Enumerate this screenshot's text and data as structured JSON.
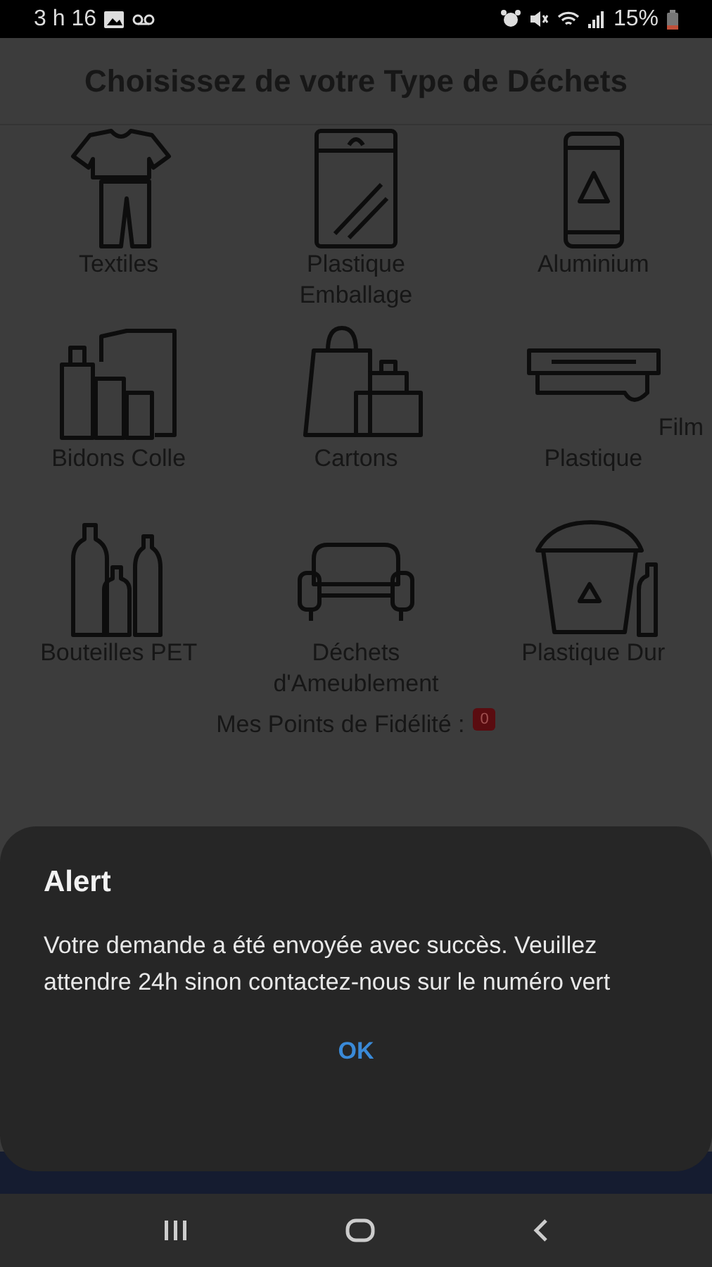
{
  "status_bar": {
    "time": "3 h 16",
    "battery": "15%"
  },
  "header": {
    "title": "Choisissez de votre Type de Déchets"
  },
  "waste_types": [
    {
      "label": "Textiles"
    },
    {
      "label": "Plastique Emballage"
    },
    {
      "label": "Aluminium"
    },
    {
      "label": "Bidons Colle"
    },
    {
      "label": "Cartons"
    },
    {
      "label": "Plastique",
      "note": "Film"
    },
    {
      "label": "Bouteilles PET"
    },
    {
      "label": "Déchets d'Ameublement"
    },
    {
      "label": "Plastique Dur"
    }
  ],
  "loyalty": {
    "label": "Mes Points de Fidélité :",
    "points": "0"
  },
  "dialog": {
    "title": "Alert",
    "message": "Votre demande a été envoyée avec succès. Veuillez attendre 24h sinon contactez-nous sur le numéro vert",
    "button": "OK"
  }
}
